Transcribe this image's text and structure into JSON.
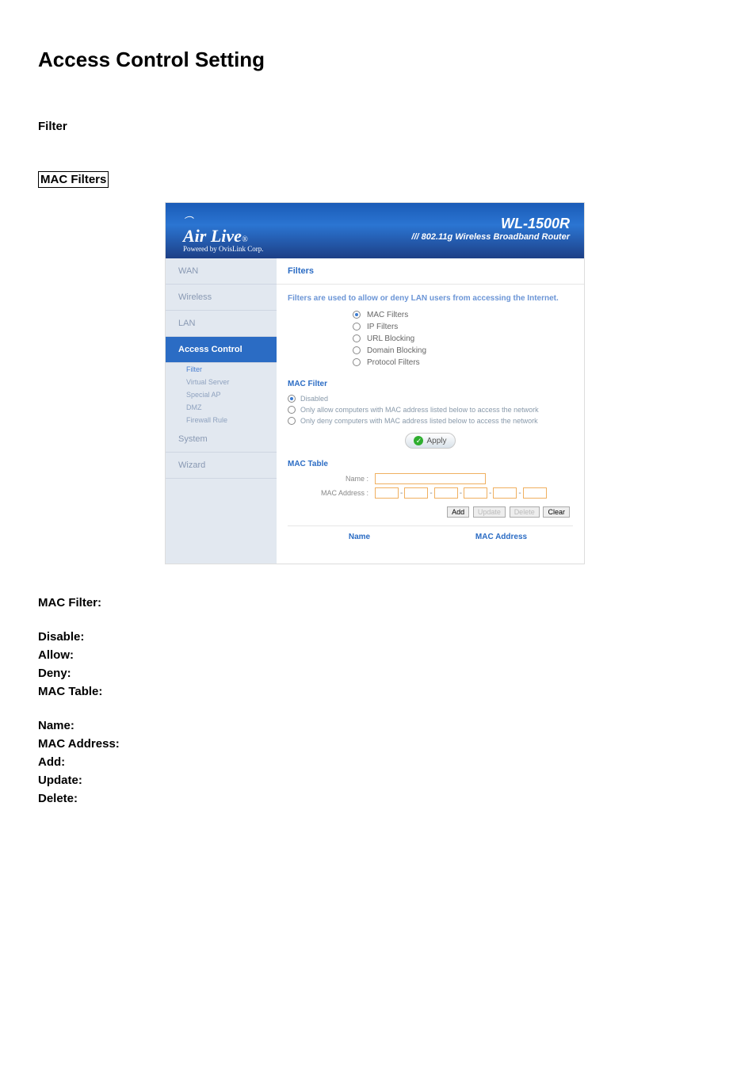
{
  "page": {
    "title": "Access Control Setting",
    "filter_label": "Filter",
    "mac_filters_label": "MAC Filters"
  },
  "router": {
    "logo": {
      "wifi_glyph": "⌒",
      "brand": "Air Live",
      "reg": "®",
      "powered": "Powered by OvisLink Corp."
    },
    "model": "WL-1500R",
    "subtitle": "/// 802.11g Wireless Broadband Router",
    "side": {
      "items": [
        {
          "label": "WAN",
          "active": false
        },
        {
          "label": "Wireless",
          "active": false
        },
        {
          "label": "LAN",
          "active": false
        },
        {
          "label": "Access Control",
          "active": true
        },
        {
          "label": "System",
          "active": false
        },
        {
          "label": "Wizard",
          "active": false
        }
      ],
      "sub_access_control": [
        {
          "label": "Filter",
          "active": true
        },
        {
          "label": "Virtual Server",
          "active": false
        },
        {
          "label": "Special AP",
          "active": false
        },
        {
          "label": "DMZ",
          "active": false
        },
        {
          "label": "Firewall Rule",
          "active": false
        }
      ]
    },
    "main": {
      "title": "Filters",
      "hint": "Filters are used to allow or deny LAN users from accessing the Internet.",
      "filter_types": [
        {
          "label": "MAC Filters",
          "checked": true
        },
        {
          "label": "IP Filters",
          "checked": false
        },
        {
          "label": "URL Blocking",
          "checked": false
        },
        {
          "label": "Domain Blocking",
          "checked": false
        },
        {
          "label": "Protocol Filters",
          "checked": false
        }
      ],
      "mac_filter": {
        "title": "MAC Filter",
        "options": [
          {
            "label": "Disabled",
            "checked": true
          },
          {
            "label": "Only allow computers with MAC address listed below to access the network",
            "checked": false
          },
          {
            "label": "Only deny computers with MAC address listed below to access the network",
            "checked": false
          }
        ],
        "apply_label": "Apply"
      },
      "mac_table": {
        "title": "MAC Table",
        "name_label": "Name :",
        "mac_label": "MAC Address :",
        "name_value": "",
        "mac_parts": [
          "",
          "",
          "",
          "",
          "",
          ""
        ],
        "buttons": {
          "add": "Add",
          "update": "Update",
          "delete": "Delete",
          "clear": "Clear"
        },
        "cols": {
          "name": "Name",
          "mac": "MAC Address"
        }
      }
    }
  },
  "definitions": {
    "mac_filter_heading": "MAC Filter:",
    "block1": [
      {
        "label": "Disable:"
      },
      {
        "label": "Allow:"
      },
      {
        "label": "Deny:"
      },
      {
        "label": "MAC Table:"
      }
    ],
    "block2": [
      {
        "label": "Name:"
      },
      {
        "label": "MAC Address:"
      },
      {
        "label": "Add:"
      },
      {
        "label": "Update:"
      },
      {
        "label": "Delete:"
      }
    ]
  }
}
